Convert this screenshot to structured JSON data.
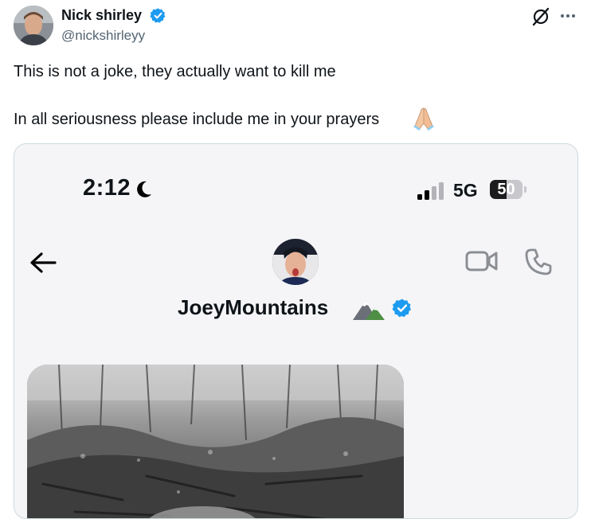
{
  "tweet": {
    "author": {
      "display_name": "Nick shirley",
      "handle": "@nickshirleyy",
      "verified": true
    },
    "text_lines": [
      "This is not a joke, they actually want to kill me",
      "In all seriousness please include me in your prayers"
    ],
    "emoji": "folded-hands-emoji",
    "actions": {
      "grok_icon": "grok-icon",
      "more_icon": "more-icon"
    }
  },
  "screenshot": {
    "status_bar": {
      "time": "2:12",
      "network": "5G",
      "battery_level": "50",
      "battery_fraction": 0.5
    },
    "chat_header": {
      "contact_name": "JoeyMountains",
      "verified": true,
      "icons": [
        "back-arrow-icon",
        "video-call-icon",
        "phone-call-icon",
        "mountain-emoji"
      ]
    },
    "message": {
      "type": "photo",
      "description_icon": "image-attachment"
    }
  },
  "colors": {
    "text_primary": "#0f1419",
    "text_secondary": "#536471",
    "verified_blue": "#1d9bf0",
    "card_border": "#cfd9de",
    "card_bg": "#f5f5f7"
  }
}
